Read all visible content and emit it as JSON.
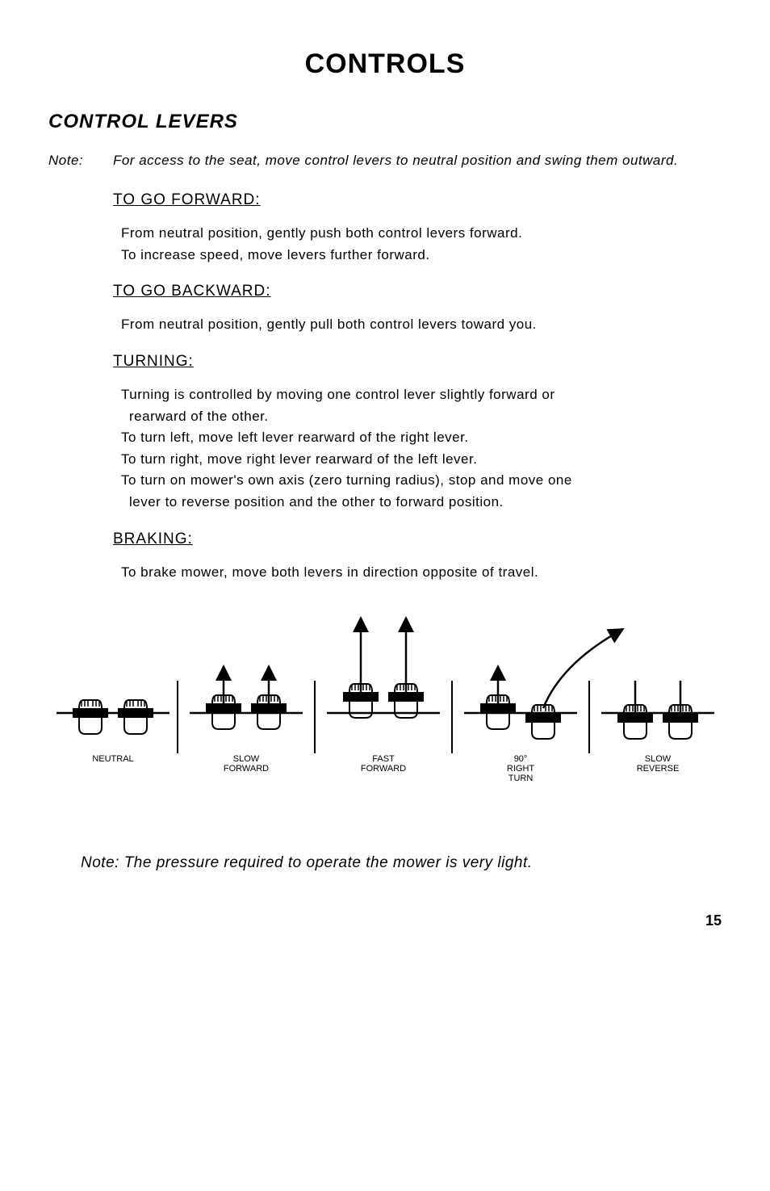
{
  "title": "CONTROLS",
  "section": "CONTROL LEVERS",
  "note1": {
    "label": "Note:",
    "text": "For access to the seat, move control levers to neutral position and swing them outward."
  },
  "forward": {
    "heading": "TO GO FORWARD:",
    "line1": "From neutral position, gently push both control levers forward.",
    "line2": "To increase speed, move levers further forward."
  },
  "backward": {
    "heading": "TO GO BACKWARD:",
    "line1": "From neutral position, gently pull both control levers toward you."
  },
  "turning": {
    "heading": "TURNING:",
    "line1": "Turning is controlled by moving one control lever slightly forward or",
    "line1b": "rearward of the other.",
    "line2": "To turn left, move left lever rearward of the right lever.",
    "line3": "To turn right, move right lever rearward of the left lever.",
    "line4": "To turn on mower's own axis (zero turning radius), stop and move one",
    "line4b": "lever to reverse position and the other to forward position."
  },
  "braking": {
    "heading": "BRAKING:",
    "line1": "To brake mower, move both levers in direction opposite of travel."
  },
  "diagram_labels": {
    "neutral": "NEUTRAL",
    "slow_fwd": "SLOW\nFORWARD",
    "fast_fwd": "FAST\nFORWARD",
    "right_turn": "90°\nRIGHT\nTURN",
    "slow_rev": "SLOW\nREVERSE"
  },
  "closing_note": "Note:  The pressure required to operate the mower is very light.",
  "page_number": "15"
}
